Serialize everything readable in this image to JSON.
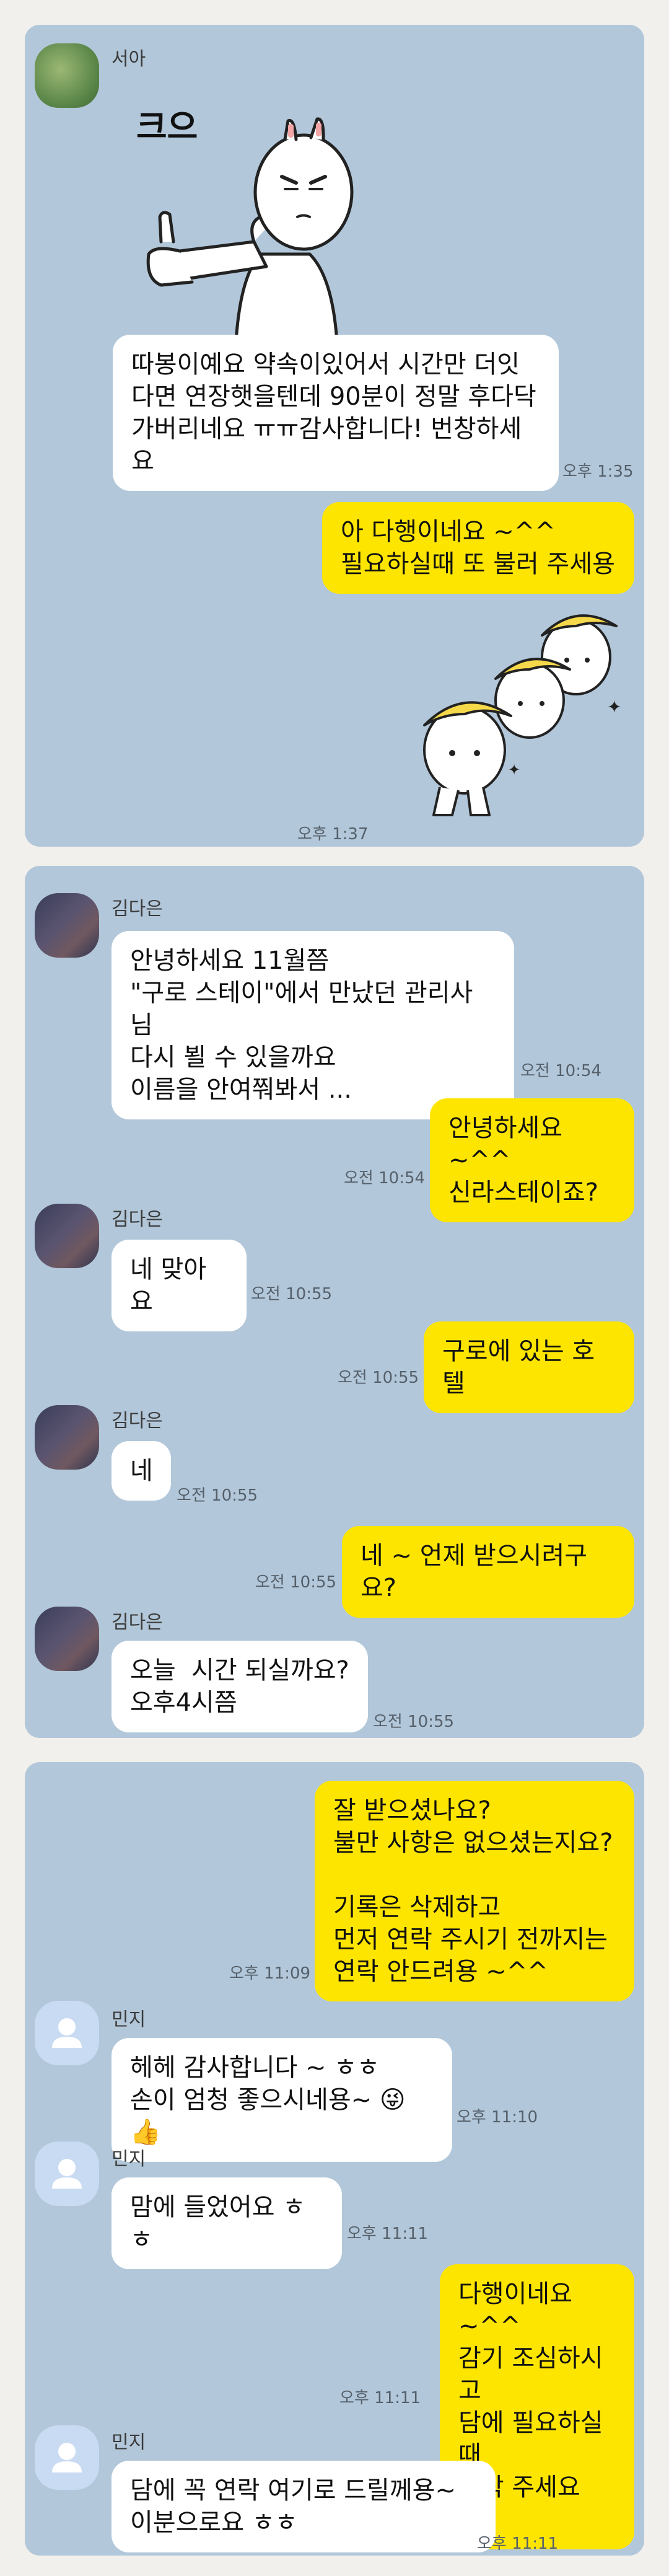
{
  "conversations": [
    {
      "messages": [
        {
          "sender": "서아",
          "sticker": "thumbs-up-bunny-sticker",
          "sticker_text": "크으"
        },
        {
          "sender": "서아",
          "text": "따봉이예요 약속이있어서 시간만 더잇\n다면 연장햇을텐데 90분이 정말 후다닥\n가버리네요 ㅠㅠ감사합니다! 번창하세\n요",
          "time": "오후 1:35"
        },
        {
          "sender": "me",
          "text": "아 다행이네요 ~^^\n필요하실때 또 불러 주세용"
        },
        {
          "sender": "me",
          "sticker": "banana-bunnies-sticker",
          "time": "오후 1:37"
        }
      ]
    },
    {
      "messages": [
        {
          "sender": "김다은",
          "text": "안녕하세요 11월쯤\n\"구로 스테이\"에서 만났던 관리사님\n다시 뵐 수 있을까요\n이름을 안여쭤봐서 ...",
          "time": "오전 10:54"
        },
        {
          "sender": "me",
          "text": "안녕하세요 ~^^\n신라스테이죠?",
          "time": "오전 10:54"
        },
        {
          "sender": "김다은",
          "text": "네 맞아요",
          "time": "오전 10:55"
        },
        {
          "sender": "me",
          "text": "구로에 있는 호텔",
          "time": "오전 10:55"
        },
        {
          "sender": "김다은",
          "text": "네",
          "time": "오전 10:55"
        },
        {
          "sender": "me",
          "text": "네 ~ 언제 받으시려구요?",
          "time": "오전 10:55"
        },
        {
          "sender": "김다은",
          "text": "오늘  시간 되실까요?\n오후4시쯤",
          "time": "오전 10:55"
        }
      ]
    },
    {
      "messages": [
        {
          "sender": "me",
          "text": "잘 받으셨나요?\n불만 사항은 없으셨는지요?\n\n기록은 삭제하고\n먼저 연락 주시기 전까지는\n연락 안드려용 ~^^",
          "time": "오후 11:09"
        },
        {
          "sender": "민지",
          "text": "헤헤 감사합니다 ~ ㅎㅎ\n손이 엄청 좋으시네용~ 😜👍",
          "time": "오후 11:10"
        },
        {
          "sender": "민지",
          "text": "맘에 들었어요 ㅎㅎ",
          "time": "오후 11:11"
        },
        {
          "sender": "me",
          "text": "다행이네요 ~^^\n감기 조심하시고\n담에 필요하실때\n연락 주세요 !!!",
          "time": "오후 11:11"
        },
        {
          "sender": "민지",
          "text": "담에 꼭 연락 여기로 드릴께용~\n이분으로요 ㅎㅎ",
          "time": "오후 11:11"
        }
      ]
    }
  ],
  "colors": {
    "chat_bg": "#b2c7d9",
    "my_bubble": "#fee500",
    "their_bubble": "#ffffff",
    "page_bg": "#f2f0ed"
  }
}
